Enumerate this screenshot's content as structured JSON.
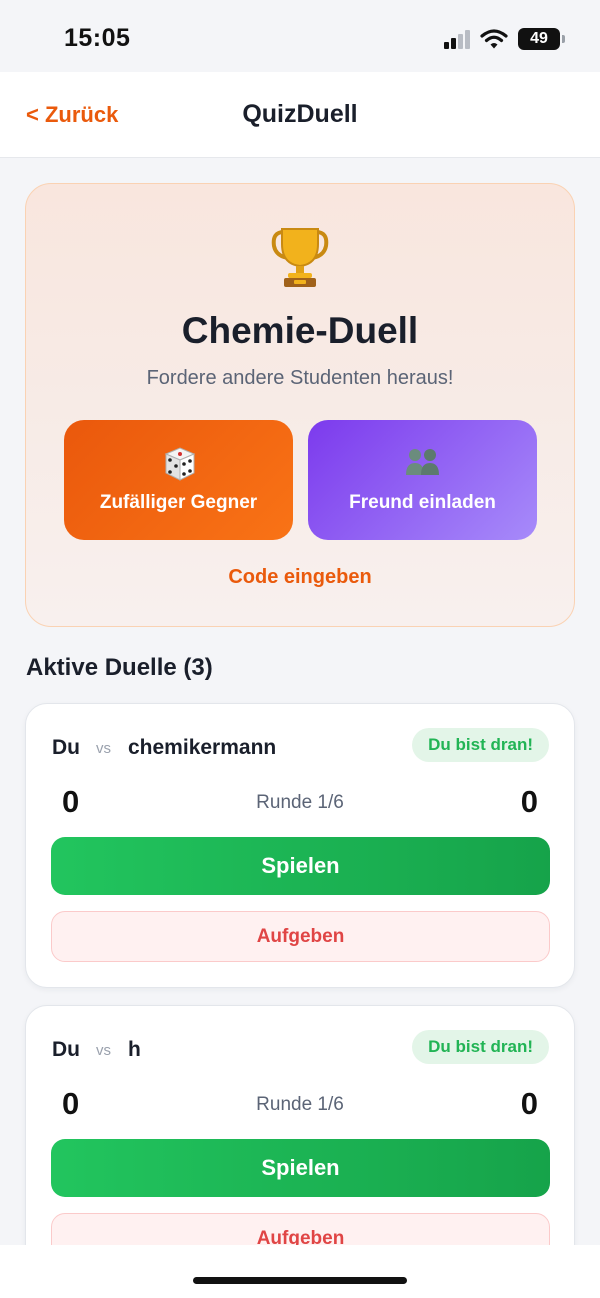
{
  "status_bar": {
    "time": "15:05",
    "battery": "49"
  },
  "nav": {
    "back_label": "< Zurück",
    "title": "QuizDuell"
  },
  "hero": {
    "icon": "trophy-icon",
    "title": "Chemie-Duell",
    "subtitle": "Fordere andere Studenten heraus!",
    "random_button": {
      "icon": "dice-icon",
      "label": "Zufälliger Gegner",
      "color": "#ea580c"
    },
    "invite_button": {
      "icon": "people-icon",
      "label": "Freund einladen",
      "color": "#7c3aed"
    },
    "code_link": "Code eingeben"
  },
  "active_duels": {
    "title": "Aktive Duelle (3)",
    "items": [
      {
        "player": "Du",
        "vs": "vs",
        "opponent": "chemikermann",
        "badge": "Du bist dran!",
        "score_left": "0",
        "score_right": "0",
        "round": "Runde 1/6",
        "play_label": "Spielen",
        "giveup_label": "Aufgeben"
      },
      {
        "player": "Du",
        "vs": "vs",
        "opponent": "h",
        "badge": "Du bist dran!",
        "score_left": "0",
        "score_right": "0",
        "round": "Runde 1/6",
        "play_label": "Spielen",
        "giveup_label": "Aufgeben"
      }
    ]
  },
  "colors": {
    "accent": "#ea5a0c",
    "play": "#22c55e",
    "giveup": "#e04545",
    "badge": "#22b455"
  }
}
